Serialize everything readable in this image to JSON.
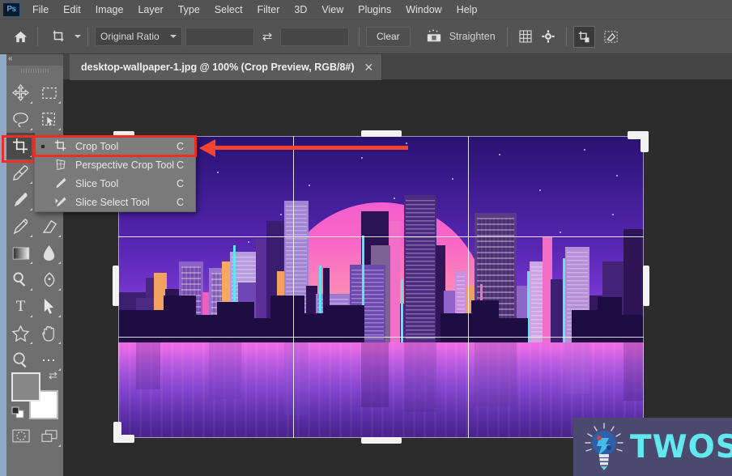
{
  "app": {
    "name": "Adobe Photoshop",
    "logo_text": "Ps"
  },
  "menubar": {
    "items": [
      {
        "label": "File"
      },
      {
        "label": "Edit"
      },
      {
        "label": "Image"
      },
      {
        "label": "Layer"
      },
      {
        "label": "Type"
      },
      {
        "label": "Select"
      },
      {
        "label": "Filter"
      },
      {
        "label": "3D"
      },
      {
        "label": "View"
      },
      {
        "label": "Plugins"
      },
      {
        "label": "Window"
      },
      {
        "label": "Help"
      }
    ]
  },
  "optionsbar": {
    "home_icon": "home-icon",
    "tool_preset_icon": "crop-tool-preset-icon",
    "ratio_select": {
      "value": "Original Ratio",
      "chevron": "chevron-down-icon"
    },
    "width_field": {
      "value": "",
      "placeholder": ""
    },
    "swap_icon": "swap-width-height-icon",
    "height_field": {
      "value": "",
      "placeholder": ""
    },
    "clear_label": "Clear",
    "straighten_icon": "straighten-icon",
    "straighten_label": "Straighten",
    "overlay_icon": "grid-overlay-icon",
    "settings_icon": "gear-icon",
    "delete_cropped_icon": "delete-cropped-pixels-icon",
    "content_aware_icon": "content-aware-fill-icon"
  },
  "tab": {
    "title": "desktop-wallpaper-1.jpg @ 100% (Crop Preview, RGB/8#)",
    "close_icon": "close-icon"
  },
  "toolpanel": {
    "collapse_icon": "collapse-panel-icon",
    "grip_icon": "drag-grip-icon",
    "tools": [
      {
        "name": "move-tool"
      },
      {
        "name": "rectangular-marquee-tool"
      },
      {
        "name": "lasso-tool"
      },
      {
        "name": "object-selection-tool"
      },
      {
        "name": "crop-tool",
        "active": true
      },
      {
        "name": "frame-tool"
      },
      {
        "name": "eyedropper-tool"
      },
      {
        "name": "spot-healing-brush-tool"
      },
      {
        "name": "brush-tool"
      },
      {
        "name": "clone-stamp-tool"
      },
      {
        "name": "history-brush-tool"
      },
      {
        "name": "eraser-tool"
      },
      {
        "name": "gradient-tool"
      },
      {
        "name": "blur-tool"
      },
      {
        "name": "dodge-tool"
      },
      {
        "name": "pen-tool"
      },
      {
        "name": "horizontal-type-tool"
      },
      {
        "name": "path-selection-tool"
      },
      {
        "name": "custom-shape-tool"
      },
      {
        "name": "hand-tool"
      },
      {
        "name": "zoom-tool"
      },
      {
        "name": "edit-toolbar-tool"
      }
    ],
    "foreground_color": "#878787",
    "background_color": "#ffffff",
    "swap_colors_icon": "swap-colors-icon",
    "default_colors_icon": "default-colors-icon",
    "quick_mask_icon": "quick-mask-icon",
    "screen_mode_icon": "screen-mode-icon"
  },
  "flyout": {
    "items": [
      {
        "label": "Crop Tool",
        "shortcut": "C",
        "icon": "crop-tool-icon",
        "selected": true,
        "current": true
      },
      {
        "label": "Perspective Crop Tool",
        "shortcut": "C",
        "icon": "perspective-crop-tool-icon",
        "selected": false,
        "current": false
      },
      {
        "label": "Slice Tool",
        "shortcut": "C",
        "icon": "slice-tool-icon",
        "selected": false,
        "current": false
      },
      {
        "label": "Slice Select Tool",
        "shortcut": "C",
        "icon": "slice-select-tool-icon",
        "selected": false,
        "current": false
      }
    ],
    "highlight_color": "#ef2d20"
  },
  "annotation": {
    "arrow_color": "#f4442e",
    "highlight_box_color": "#ef2d20",
    "points_to": "Crop Tool"
  },
  "canvas": {
    "image_name": "desktop-wallpaper-1.jpg",
    "zoom": "100%",
    "mode": "Crop Preview, RGB/8#",
    "description": "retro synthwave city skyline with large pink sun and reflective foreground",
    "crop_overlay": {
      "rule": "rule-of-thirds",
      "gridlines": 4,
      "handles": 8
    }
  },
  "watermark": {
    "text": "TWOS",
    "icon": "lightbulb-icon",
    "bg": "#4b4a6e",
    "fg": "#62e8ef"
  }
}
